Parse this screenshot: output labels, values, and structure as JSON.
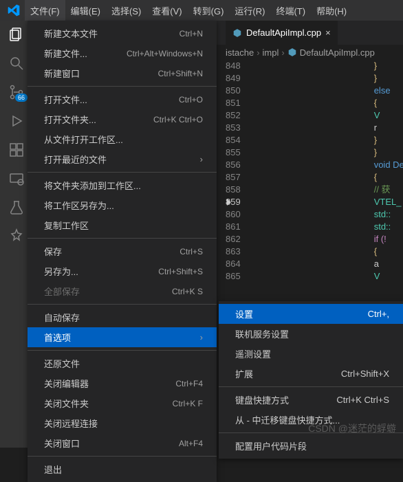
{
  "menubar": {
    "items": [
      "文件(F)",
      "编辑(E)",
      "选择(S)",
      "查看(V)",
      "转到(G)",
      "运行(R)",
      "终端(T)",
      "帮助(H)"
    ],
    "active_index": 0
  },
  "activitybar": {
    "scm_badge": "66"
  },
  "file_menu": {
    "groups": [
      [
        {
          "label": "新建文本文件",
          "shortcut": "Ctrl+N"
        },
        {
          "label": "新建文件...",
          "shortcut": "Ctrl+Alt+Windows+N"
        },
        {
          "label": "新建窗口",
          "shortcut": "Ctrl+Shift+N"
        }
      ],
      [
        {
          "label": "打开文件...",
          "shortcut": "Ctrl+O"
        },
        {
          "label": "打开文件夹...",
          "shortcut": "Ctrl+K Ctrl+O"
        },
        {
          "label": "从文件打开工作区...",
          "shortcut": ""
        },
        {
          "label": "打开最近的文件",
          "shortcut": "",
          "submenu": true
        }
      ],
      [
        {
          "label": "将文件夹添加到工作区...",
          "shortcut": ""
        },
        {
          "label": "将工作区另存为...",
          "shortcut": ""
        },
        {
          "label": "复制工作区",
          "shortcut": ""
        }
      ],
      [
        {
          "label": "保存",
          "shortcut": "Ctrl+S"
        },
        {
          "label": "另存为...",
          "shortcut": "Ctrl+Shift+S"
        },
        {
          "label": "全部保存",
          "shortcut": "Ctrl+K S",
          "disabled": true
        }
      ],
      [
        {
          "label": "自动保存",
          "shortcut": ""
        },
        {
          "label": "首选项",
          "shortcut": "",
          "submenu": true,
          "highlighted": true
        }
      ],
      [
        {
          "label": "还原文件",
          "shortcut": ""
        },
        {
          "label": "关闭编辑器",
          "shortcut": "Ctrl+F4"
        },
        {
          "label": "关闭文件夹",
          "shortcut": "Ctrl+K F"
        },
        {
          "label": "关闭远程连接",
          "shortcut": ""
        },
        {
          "label": "关闭窗口",
          "shortcut": "Alt+F4"
        }
      ],
      [
        {
          "label": "退出",
          "shortcut": ""
        }
      ]
    ]
  },
  "preferences_submenu": {
    "groups": [
      [
        {
          "label": "设置",
          "shortcut": "Ctrl+,",
          "highlighted": true
        },
        {
          "label": "联机服务设置",
          "shortcut": ""
        },
        {
          "label": "遥测设置",
          "shortcut": ""
        },
        {
          "label": "扩展",
          "shortcut": "Ctrl+Shift+X"
        }
      ],
      [
        {
          "label": "键盘快捷方式",
          "shortcut": "Ctrl+K Ctrl+S"
        },
        {
          "label": "从 - 中迁移键盘快捷方式...",
          "shortcut": ""
        }
      ],
      [
        {
          "label": "配置用户代码片段",
          "shortcut": ""
        }
      ]
    ]
  },
  "editor": {
    "tab_label": "DefaultApiImpl.cpp",
    "breadcrumb": [
      "istache",
      "impl",
      "DefaultApiImpl.cpp"
    ],
    "line_start": 848,
    "line_end": 865,
    "current_line": 859,
    "code": [
      {
        "t": "}",
        "c": "br"
      },
      {
        "t": "}",
        "c": "br"
      },
      {
        "t": "else",
        "c": "kw-else"
      },
      {
        "t": "{",
        "c": "br"
      },
      {
        "t": "V",
        "c": "ty"
      },
      {
        "t": "r",
        "c": "op"
      },
      {
        "t": "}",
        "c": "br"
      },
      {
        "t": "}",
        "c": "br"
      },
      {
        "t": "void Defa",
        "c": "kw-void"
      },
      {
        "t": "{",
        "c": "br"
      },
      {
        "t": "// 获",
        "c": "cm"
      },
      {
        "t": "VTEL_",
        "c": "ty"
      },
      {
        "t": "std::",
        "c": "ty"
      },
      {
        "t": "std::",
        "c": "ty"
      },
      {
        "t": "if (!",
        "c": "kw-if"
      },
      {
        "t": "{",
        "c": "br"
      },
      {
        "t": "a",
        "c": "op"
      },
      {
        "t": "V",
        "c": "ty"
      }
    ]
  },
  "watermark": "CSDN @迷茫的蜉蝣"
}
